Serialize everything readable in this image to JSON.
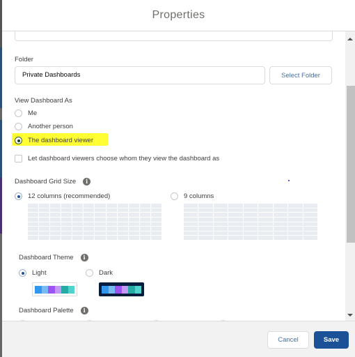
{
  "modal": {
    "title": "Properties"
  },
  "folder": {
    "label": "Folder",
    "value": "Private Dashboards",
    "select_button": "Select Folder"
  },
  "view_as": {
    "label": "View Dashboard As",
    "options": [
      {
        "label": "Me",
        "checked": false
      },
      {
        "label": "Another person",
        "checked": false
      },
      {
        "label": "The dashboard viewer",
        "checked": true,
        "highlighted": true
      }
    ],
    "checkbox_label": "Let dashboard viewers choose whom they view the dashboard as",
    "checkbox_checked": false
  },
  "grid_size": {
    "label": "Dashboard Grid Size",
    "info_icon": "info-icon",
    "options": [
      {
        "label": "12 columns (recommended)",
        "checked": true,
        "columns": 12
      },
      {
        "label": "9 columns",
        "checked": false,
        "columns": 9
      }
    ]
  },
  "theme": {
    "label": "Dashboard Theme",
    "info_icon": "info-icon",
    "options": [
      {
        "label": "Light",
        "checked": true
      },
      {
        "label": "Dark",
        "checked": false
      }
    ],
    "swatch_colors": [
      "#3296ed",
      "#77b9f2",
      "#9d53f2",
      "#c398f5",
      "#26aba4",
      "#4ed4cd"
    ],
    "dark_background": "#061c3f"
  },
  "palette": {
    "label": "Dashboard Palette",
    "info_icon": "info-icon"
  },
  "footer": {
    "cancel_label": "Cancel",
    "save_label": "Save"
  },
  "colors": {
    "brand": "#1b5297",
    "highlight": "#ffff33"
  }
}
